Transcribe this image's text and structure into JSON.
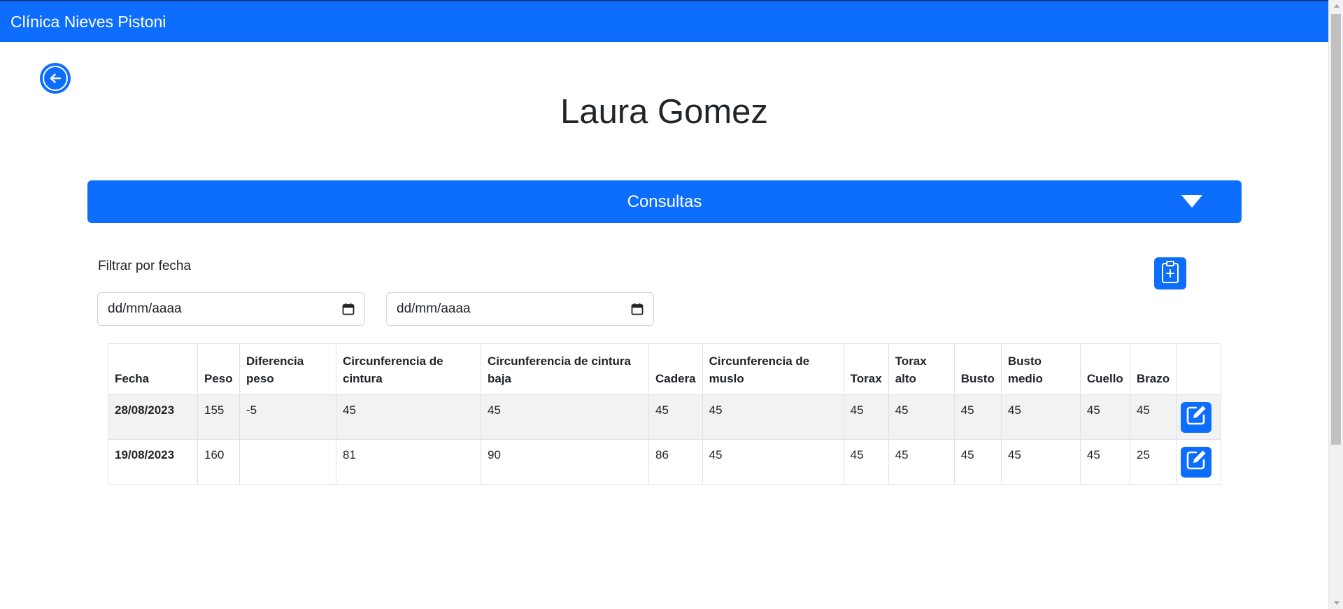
{
  "navbar": {
    "brand": "Clínica Nieves Pistoni"
  },
  "page": {
    "title": "Laura Gomez"
  },
  "accordion": {
    "label": "Consultas"
  },
  "filter": {
    "label": "Filtrar por fecha",
    "from_value": "dd/mm/aaaa",
    "to_value": "dd/mm/aaaa"
  },
  "table": {
    "headers": [
      "Fecha",
      "Peso",
      "Diferencia peso",
      "Circunferencia de cintura",
      "Circunferencia de cintura baja",
      "Cadera",
      "Circunferencia de muslo",
      "Torax",
      "Torax alto",
      "Busto",
      "Busto medio",
      "Cuello",
      "Brazo",
      ""
    ],
    "rows": [
      [
        "28/08/2023",
        "155",
        "-5",
        "45",
        "45",
        "45",
        "45",
        "45",
        "45",
        "45",
        "45",
        "45",
        "45"
      ],
      [
        "19/08/2023",
        "160",
        "",
        "81",
        "90",
        "86",
        "45",
        "45",
        "45",
        "45",
        "45",
        "45",
        "25"
      ]
    ]
  },
  "colors": {
    "primary": "#0d6efd",
    "stripe": "#f2f2f2",
    "border": "#dee2e6"
  },
  "icons": {
    "back": "arrow-left-circle-icon",
    "toggle": "caret-down-icon",
    "add": "clipboard-plus-icon",
    "calendar": "calendar-icon",
    "edit": "pencil-square-icon"
  }
}
